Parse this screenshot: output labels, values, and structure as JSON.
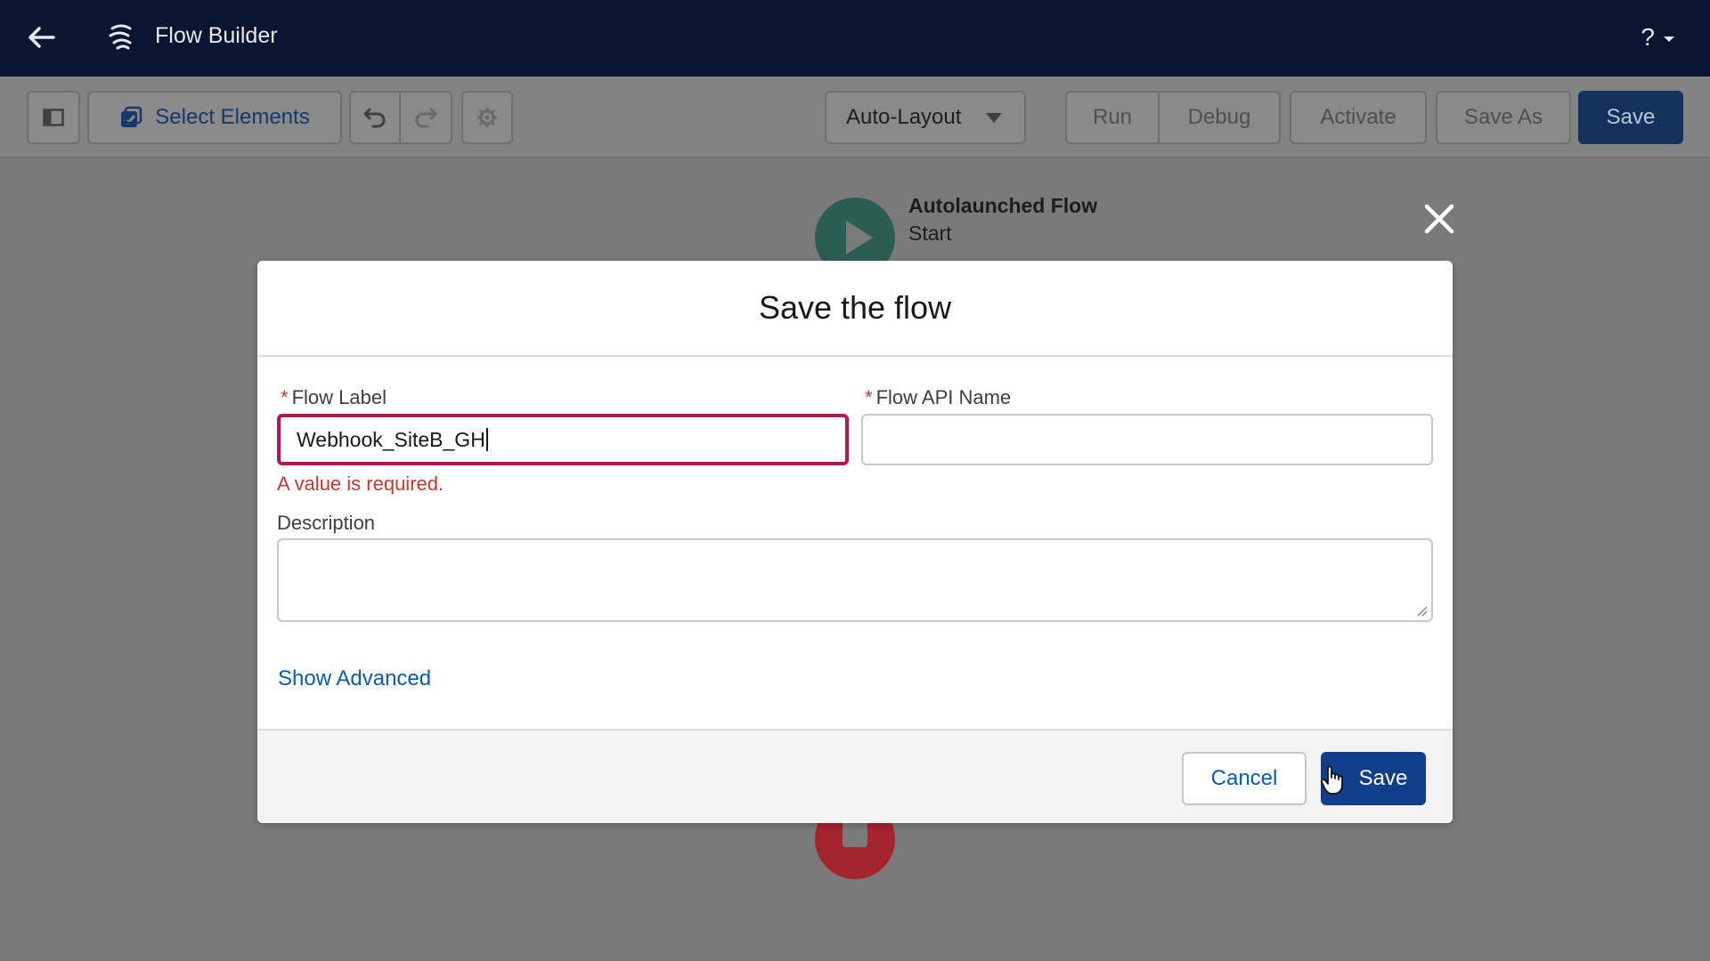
{
  "header": {
    "app_title": "Flow Builder",
    "help_label": "?",
    "back_icon": "back-arrow-icon",
    "app_icon": "flow-builder-icon"
  },
  "toolbar": {
    "select_elements_label": "Select Elements",
    "layout_select": "Auto-Layout",
    "run_label": "Run",
    "debug_label": "Debug",
    "activate_label": "Activate",
    "save_as_label": "Save As",
    "save_label": "Save"
  },
  "canvas": {
    "start_title": "Autolaunched Flow",
    "start_subtitle": "Start"
  },
  "modal": {
    "title": "Save the flow",
    "required_marker": "*",
    "flow_label": {
      "label": "Flow Label",
      "value": "Webhook_SiteB_GH",
      "error": "A value is required."
    },
    "flow_api_name": {
      "label": "Flow API Name",
      "value": ""
    },
    "description": {
      "label": "Description",
      "value": ""
    },
    "show_advanced": "Show Advanced",
    "cancel_label": "Cancel",
    "save_label": "Save"
  },
  "colors": {
    "header_bg": "#0a1532",
    "brand_blue": "#0f3f8a",
    "link_blue": "#0b5cab",
    "error_red": "#c23934",
    "error_border": "#b8164a",
    "start_green": "#2a5e55",
    "end_red": "#a4232e"
  }
}
